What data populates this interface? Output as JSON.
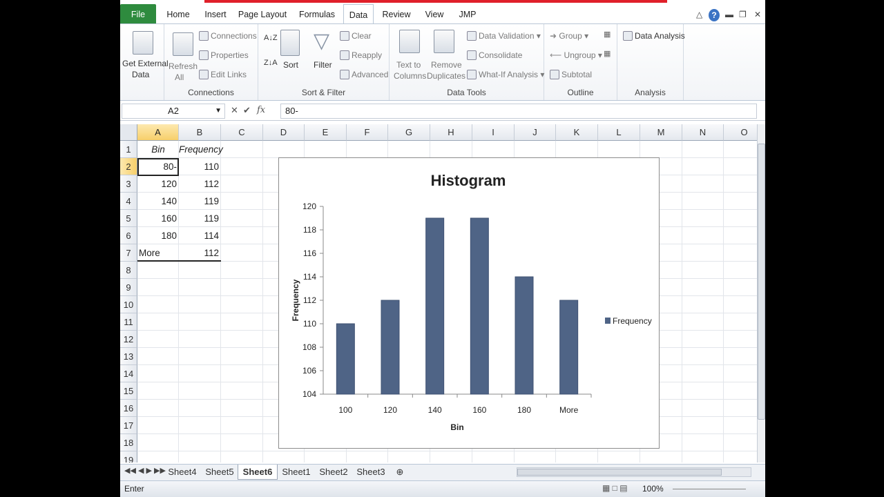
{
  "tabs": [
    "File",
    "Home",
    "Insert",
    "Page Layout",
    "Formulas",
    "Data",
    "Review",
    "View",
    "JMP"
  ],
  "ribbon": {
    "get_external": "Get External",
    "get_external2": "Data",
    "refresh": "Refresh",
    "refresh2": "All",
    "connections": "Connections",
    "properties": "Properties",
    "edit_links": "Edit Links",
    "connections_group": "Connections",
    "sort": "Sort",
    "filter": "Filter",
    "clear": "Clear",
    "reapply": "Reapply",
    "advanced": "Advanced",
    "sort_filter_group": "Sort & Filter",
    "text_to": "Text to",
    "columns": "Columns",
    "remove": "Remove",
    "duplicates": "Duplicates",
    "data_validation": "Data Validation",
    "consolidate": "Consolidate",
    "what_if": "What-If Analysis",
    "data_tools_group": "Data Tools",
    "group": "Group",
    "ungroup": "Ungroup",
    "subtotal": "Subtotal",
    "outline_group": "Outline",
    "data_analysis": "Data Analysis",
    "analysis_group": "Analysis"
  },
  "formula_bar": {
    "name_box": "A2",
    "fx": "fx",
    "content": "80-"
  },
  "columns": [
    "A",
    "B",
    "C",
    "D",
    "E",
    "F",
    "G",
    "H",
    "I",
    "J",
    "K",
    "L",
    "M",
    "N",
    "O"
  ],
  "rows": [
    "1",
    "2",
    "3",
    "4",
    "5",
    "6",
    "7",
    "8",
    "9",
    "10",
    "11",
    "12",
    "13",
    "14",
    "15",
    "16",
    "17",
    "18",
    "19"
  ],
  "table": {
    "headers": [
      "Bin",
      "Frequency"
    ],
    "rows": [
      [
        "80-",
        "110"
      ],
      [
        "120",
        "112"
      ],
      [
        "140",
        "119"
      ],
      [
        "160",
        "119"
      ],
      [
        "180",
        "114"
      ],
      [
        "More",
        "112"
      ]
    ]
  },
  "chart_data": {
    "type": "bar",
    "title": "Histogram",
    "xlabel": "Bin",
    "ylabel": "Frequency",
    "categories": [
      "100",
      "120",
      "140",
      "160",
      "180",
      "More"
    ],
    "series": [
      {
        "name": "Frequency",
        "values": [
          110,
          112,
          119,
          119,
          114,
          112
        ],
        "color": "#4f6486"
      }
    ],
    "ylim": [
      104,
      120
    ],
    "yticks": [
      "104",
      "106",
      "108",
      "110",
      "112",
      "114",
      "116",
      "118",
      "120"
    ],
    "legend": "right"
  },
  "sheets": [
    "Sheet4",
    "Sheet5",
    "Sheet6",
    "Sheet1",
    "Sheet2",
    "Sheet3"
  ],
  "active_sheet": "Sheet6",
  "status": {
    "mode": "Enter",
    "zoom": "100%"
  }
}
